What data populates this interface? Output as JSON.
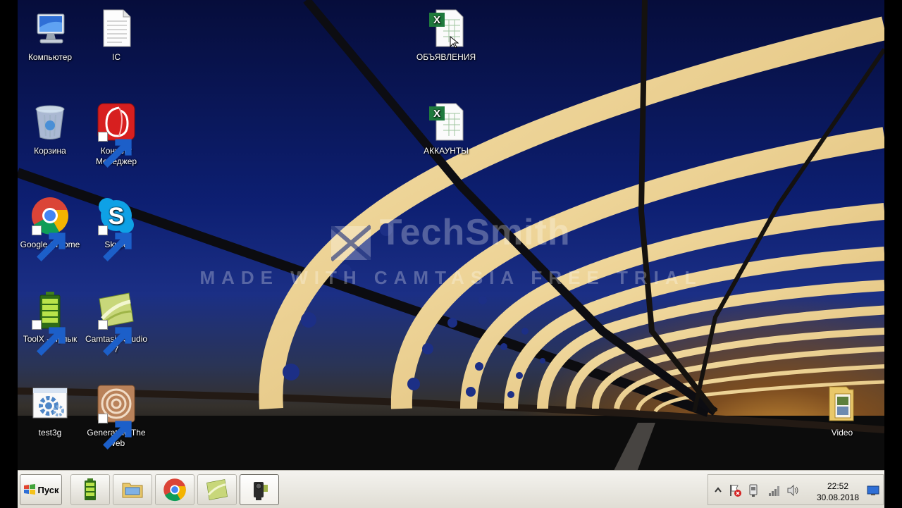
{
  "desktop": {
    "icons": {
      "computer": {
        "label": "Компьютер"
      },
      "ic": {
        "label": "IC"
      },
      "recycle_bin": {
        "label": "Корзина"
      },
      "connect_manager": {
        "label": "Коннект Менеджер"
      },
      "chrome": {
        "label": "Google Chrome"
      },
      "skype": {
        "label": "Skype"
      },
      "toolx": {
        "label": "ToolX - Ярлык"
      },
      "camtasia": {
        "label": "Camtasia Studio 7"
      },
      "test3g": {
        "label": "test3g"
      },
      "generating_web": {
        "label": "Generating The Web"
      },
      "obyavleniya": {
        "label": "ОБЪЯВЛЕНИЯ"
      },
      "akkaunty": {
        "label": "АККАУНТЫ"
      },
      "video": {
        "label": "Video"
      }
    }
  },
  "watermark": {
    "brand": "TechSmith",
    "subtitle": "MADE WITH CAMTASIA FREE TRIAL"
  },
  "taskbar": {
    "start_label": "Пуск",
    "pinned": [
      "battery-tool-icon",
      "folder-explorer-icon",
      "chrome-icon",
      "camtasia-icon",
      "camcorder-icon"
    ],
    "clock": {
      "time": "22:52",
      "date": "30.08.2018"
    }
  },
  "colors": {
    "sky_top": "#060d3b",
    "sky_mid": "#1b2f85",
    "bridge_glow": "#f3d9a0",
    "taskbar": "#e8e6de"
  }
}
